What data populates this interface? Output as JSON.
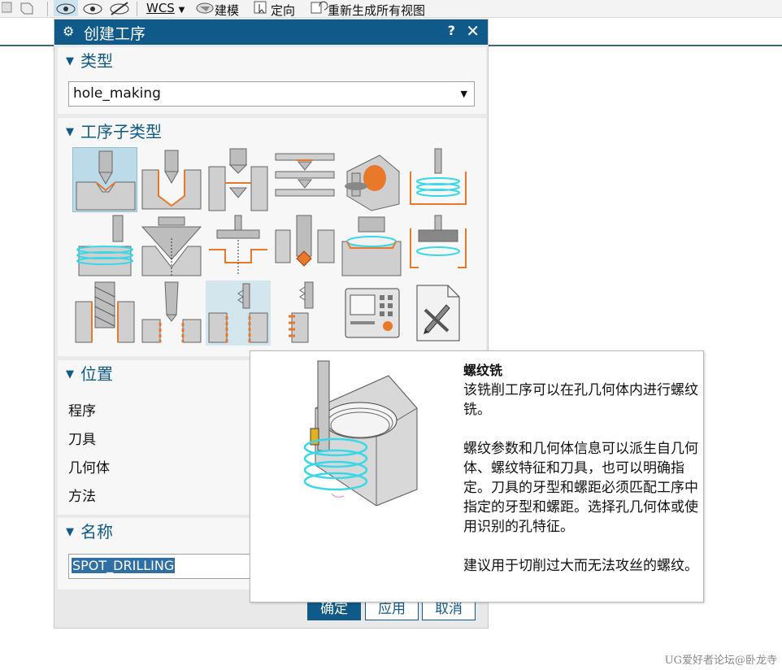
{
  "toolbar": {
    "wcs_label": "WCS",
    "model_label": "建模",
    "orient_label": "定向",
    "regen_label": "重新生成所有视图"
  },
  "dialog": {
    "title": "创建工序",
    "help_symbol": "?",
    "close_symbol": "✕"
  },
  "type_section": {
    "label": "类型",
    "selected_value": "hole_making"
  },
  "subtype_section": {
    "label": "工序子类型",
    "icons": [
      "spot-drilling-icon",
      "drilling-icon",
      "counterbore-drilling-icon",
      "multi-level-drilling-icon",
      "hole-milling-icon",
      "thread-milling-helical-icon",
      "boss-thread-milling-icon",
      "countersinking-icon",
      "counterboring-icon",
      "back-counter-sinking-icon",
      "hole-chamfer-milling-icon",
      "boss-milling-icon",
      "helical-hole-milling-icon",
      "tapping-icon",
      "thread-milling-icon",
      "boss-thread-icon",
      "sequential-operation-icon",
      "generic-operation-icon"
    ]
  },
  "position_section": {
    "label": "位置",
    "fields": [
      "程序",
      "刀具",
      "几何体",
      "方法"
    ]
  },
  "name_section": {
    "label": "名称",
    "value": "SPOT_DRILLING"
  },
  "buttons": {
    "ok": "确定",
    "apply": "应用",
    "cancel": "取消"
  },
  "tooltip": {
    "title": "螺纹铣",
    "para1": "该铣削工序可以在孔几何体内进行螺纹铣。",
    "para2": "螺纹参数和几何体信息可以派生自几何体、螺纹特征和刀具，也可以明确指定。刀具的牙型和螺距必须匹配工序中指定的牙型和螺距。选择孔几何体或使用识别的孔特征。",
    "para3": "建议用于切削过大而无法攻丝的螺纹。"
  },
  "watermark": "UG爱好者论坛@卧龙寺",
  "colors": {
    "titlebar": "#0f5a88",
    "accent_orange": "#e8782a",
    "helix_cyan": "#38d8e8",
    "selection": "#bcdae8"
  }
}
